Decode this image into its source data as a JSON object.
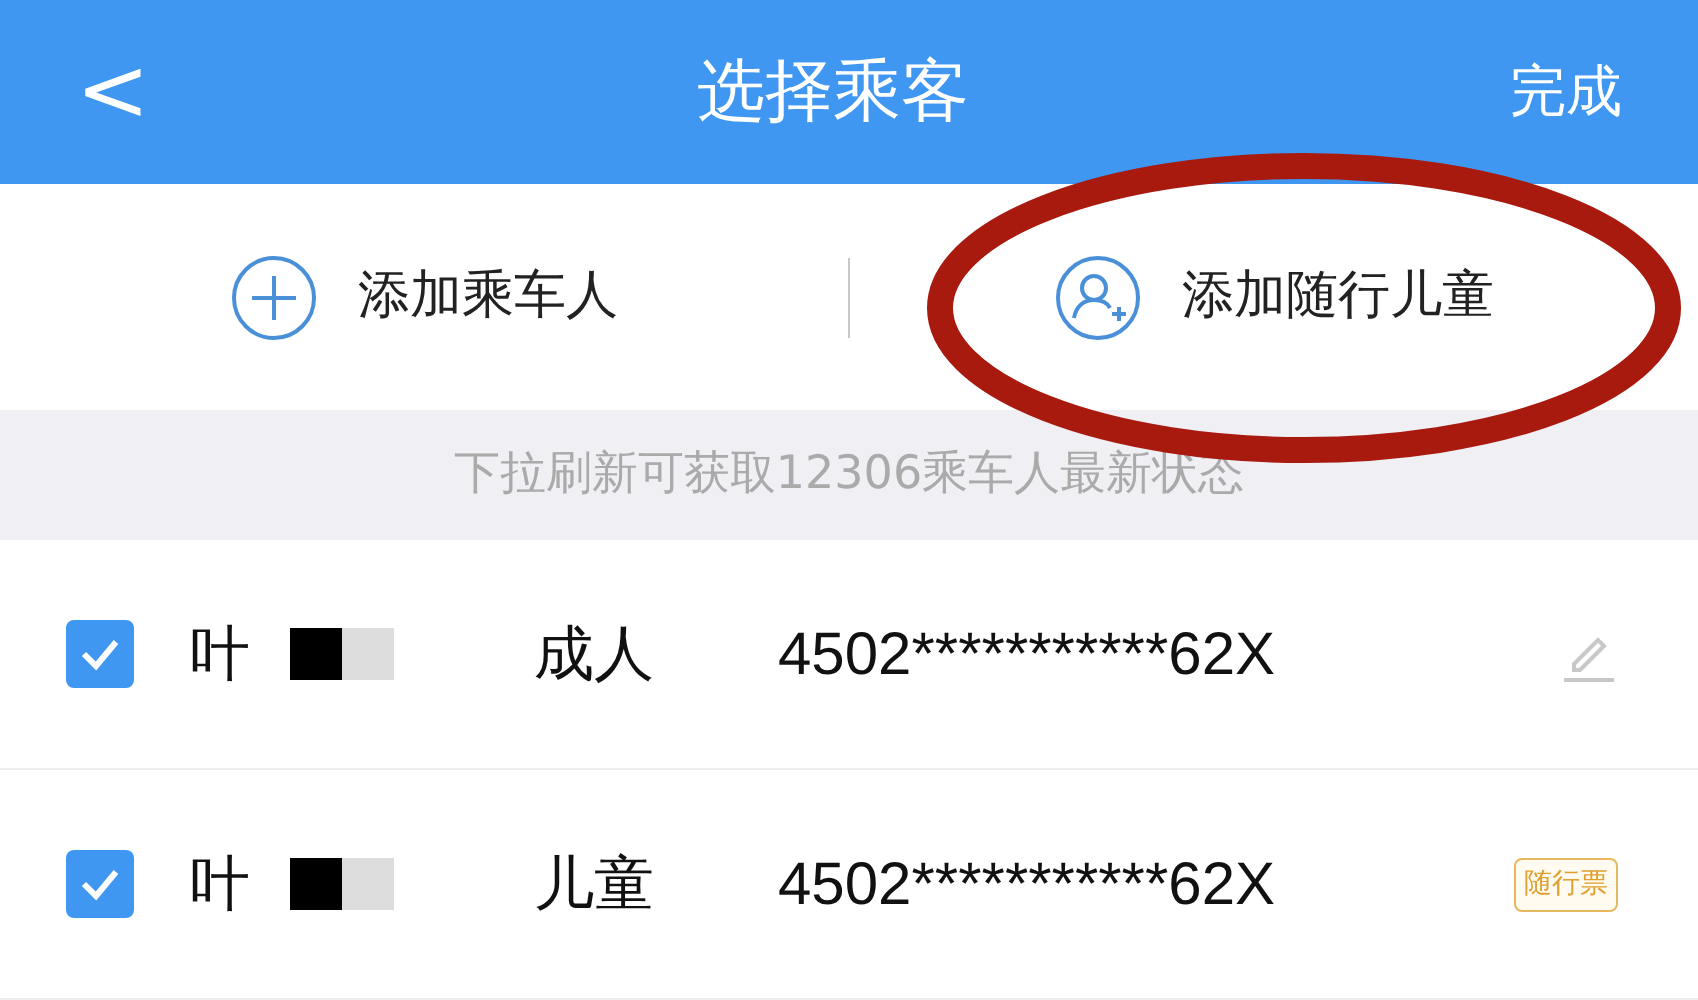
{
  "header": {
    "back": "<",
    "title": "选择乘客",
    "done": "完成"
  },
  "actions": [
    {
      "kind": "add",
      "label": "添加乘车人"
    },
    {
      "kind": "child",
      "label": "添加随行儿童",
      "highlighted": true
    }
  ],
  "notice": "下拉刷新可获取12306乘车人最新状态",
  "passengers": [
    {
      "checked": true,
      "name": "叶",
      "type": "成人",
      "id_number": "4502***********62X",
      "kind": "edit"
    },
    {
      "checked": true,
      "name": "叶",
      "type": "儿童",
      "id_number": "4502***********62X",
      "kind": "badge",
      "badge": "随行票"
    }
  ]
}
